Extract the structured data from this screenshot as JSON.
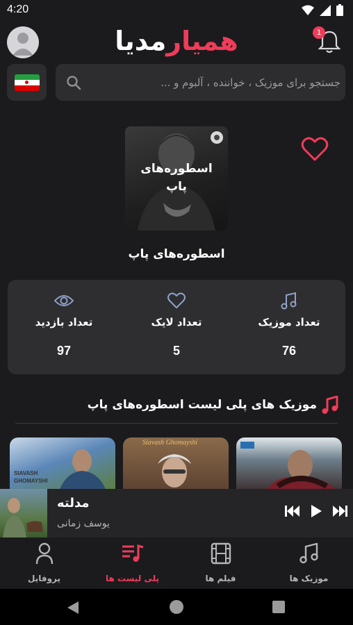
{
  "status_bar": {
    "time": "4:20"
  },
  "header": {
    "logo_part1": "همیار",
    "logo_part2": "مدیا",
    "notification_count": "1"
  },
  "search": {
    "placeholder": "جستجو برای موزیک ، خواننده ، آلبوم و ..."
  },
  "colors": {
    "accent": "#ef3c5a",
    "background": "#1b1b1d",
    "card": "#2e2e31"
  },
  "playlist": {
    "cover_text_line1": "اسطوره‌های",
    "cover_text_line2": "پاپ",
    "title": "اسطوره‌های پاپ"
  },
  "stats": [
    {
      "label": "تعداد موزیک",
      "value": "76",
      "icon": "music-note-icon"
    },
    {
      "label": "تعداد لایک",
      "value": "5",
      "icon": "heart-icon"
    },
    {
      "label": "تعداد بازدید",
      "value": "97",
      "icon": "eye-icon"
    }
  ],
  "section": {
    "title": "موزیک های پلی لیست اسطوره‌های پاپ"
  },
  "cards": [
    {
      "caption": "SIAVASH GHOMAYSHI"
    },
    {
      "caption": "Siavash Ghomayshi"
    },
    {
      "caption": ""
    }
  ],
  "player": {
    "song": "مدلته",
    "artist": "یوسف زمانی"
  },
  "bottom_nav": [
    {
      "label": "موزیک ها",
      "icon": "music-note-icon",
      "active": false
    },
    {
      "label": "فیلم ها",
      "icon": "film-icon",
      "active": false
    },
    {
      "label": "پلی لیست ها",
      "icon": "playlist-icon",
      "active": true
    },
    {
      "label": "پروفایل",
      "icon": "person-icon",
      "active": false
    }
  ]
}
